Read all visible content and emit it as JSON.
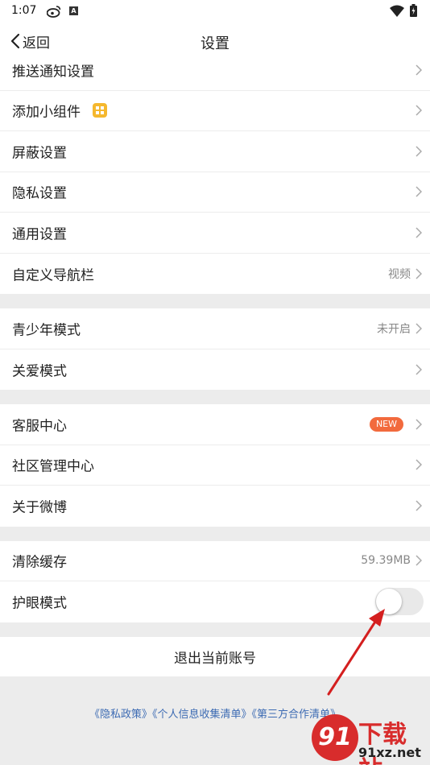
{
  "status_bar": {
    "time": "1:07",
    "a_badge": "A"
  },
  "nav": {
    "back_label": "返回",
    "title": "设置"
  },
  "groups": [
    {
      "rows": [
        {
          "label": "推送通知设置"
        },
        {
          "label": "添加小组件"
        },
        {
          "label": "屏蔽设置"
        },
        {
          "label": "隐私设置"
        },
        {
          "label": "通用设置"
        },
        {
          "label": "自定义导航栏",
          "value": "视频"
        }
      ]
    },
    {
      "rows": [
        {
          "label": "青少年模式",
          "value": "未开启"
        },
        {
          "label": "关爱模式"
        }
      ]
    },
    {
      "rows": [
        {
          "label": "客服中心",
          "badge": "NEW"
        },
        {
          "label": "社区管理中心"
        },
        {
          "label": "关于微博"
        }
      ]
    },
    {
      "rows": [
        {
          "label": "清除缓存",
          "value": "59.39MB"
        },
        {
          "label": "护眼模式",
          "toggle_on": false
        }
      ]
    }
  ],
  "logout_label": "退出当前账号",
  "footer_links": [
    "《隐私政策》",
    "《个人信息收集清单》",
    "《第三方合作清单》"
  ],
  "watermark": {
    "mark": "91",
    "title": "下载站",
    "domain": "91xz.net"
  },
  "colors": {
    "badge": "#f26a3d",
    "link": "#3d6bb3",
    "arrow": "#d41f1f",
    "watermark": "#d82c2c"
  }
}
